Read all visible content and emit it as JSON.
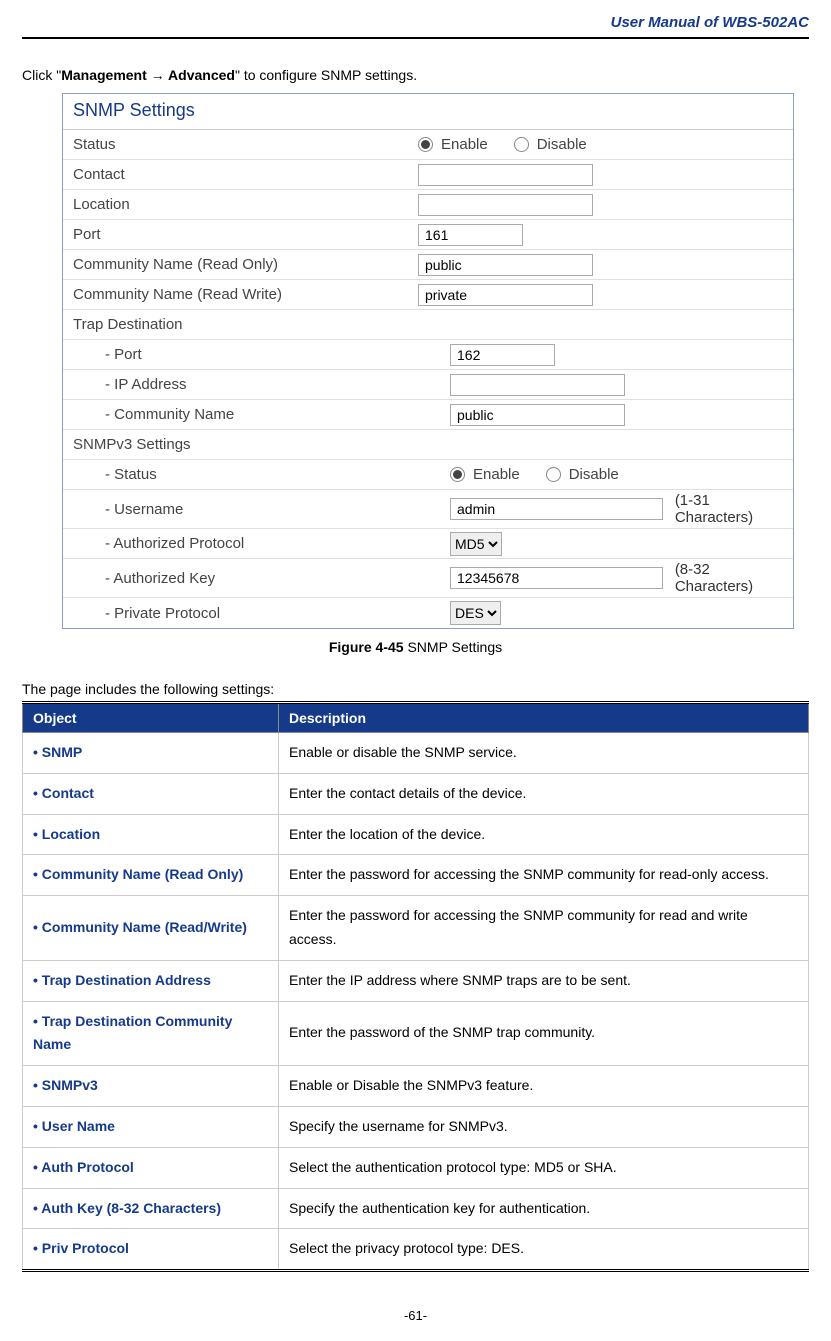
{
  "header": {
    "title": "User Manual of WBS-502AC"
  },
  "intro": {
    "prefix": "Click \"",
    "nav1": "Management",
    "arrow": " → ",
    "nav2": "Advanced",
    "suffix": "\" to configure SNMP settings."
  },
  "figure": {
    "title": "SNMP Settings",
    "rows": {
      "status_label": "Status",
      "status_enable": "Enable",
      "status_disable": "Disable",
      "contact_label": "Contact",
      "contact_value": "",
      "location_label": "Location",
      "location_value": "",
      "port_label": "Port",
      "port_value": "161",
      "cn_ro_label": "Community Name (Read Only)",
      "cn_ro_value": "public",
      "cn_rw_label": "Community Name (Read Write)",
      "cn_rw_value": "private",
      "trap_section": "Trap Destination",
      "trap_port_label": "Port",
      "trap_port_value": "162",
      "trap_ip_label": "IP Address",
      "trap_ip_value": "",
      "trap_cn_label": "Community Name",
      "trap_cn_value": "public",
      "v3_section": "SNMPv3 Settings",
      "v3_status_label": "Status",
      "v3_status_enable": "Enable",
      "v3_status_disable": "Disable",
      "v3_user_label": "Username",
      "v3_user_value": "admin",
      "v3_user_hint": "(1-31 Characters)",
      "v3_aproto_label": "Authorized Protocol",
      "v3_aproto_value": "MD5",
      "v3_akey_label": "Authorized Key",
      "v3_akey_value": "12345678",
      "v3_akey_hint": "(8-32 Characters)",
      "v3_pproto_label": "Private Protocol",
      "v3_pproto_value": "DES"
    }
  },
  "caption": {
    "bold": "Figure 4-45",
    "rest": " SNMP Settings"
  },
  "tableIntro": "The page includes the following settings:",
  "tableHeaders": {
    "object": "Object",
    "description": "Description"
  },
  "tableRows": [
    {
      "obj": "SNMP",
      "desc": "Enable or disable the SNMP service."
    },
    {
      "obj": "Contact",
      "desc": "Enter the contact details of the device."
    },
    {
      "obj": "Location",
      "desc": "Enter the location of the device."
    },
    {
      "obj": "Community Name (Read Only)",
      "desc": "Enter the password for accessing the SNMP community for read-only access."
    },
    {
      "obj": "Community Name (Read/Write)",
      "desc": "Enter the password for accessing the SNMP community for read and write access."
    },
    {
      "obj": "Trap Destination Address",
      "desc": "Enter the IP address where SNMP traps are to be sent."
    },
    {
      "obj": "Trap Destination Community Name",
      "desc": "Enter the password of the SNMP trap community."
    },
    {
      "obj": "SNMPv3",
      "desc": "Enable or Disable the SNMPv3 feature."
    },
    {
      "obj": "User Name",
      "desc": "Specify the username for SNMPv3."
    },
    {
      "obj": "Auth Protocol",
      "desc": "Select the authentication protocol type: MD5 or SHA."
    },
    {
      "obj": "Auth Key (8-32 Characters)",
      "desc": "Specify the authentication key for authentication."
    },
    {
      "obj": "Priv Protocol",
      "desc": "Select the privacy protocol type: DES."
    }
  ],
  "footer": "-61-"
}
